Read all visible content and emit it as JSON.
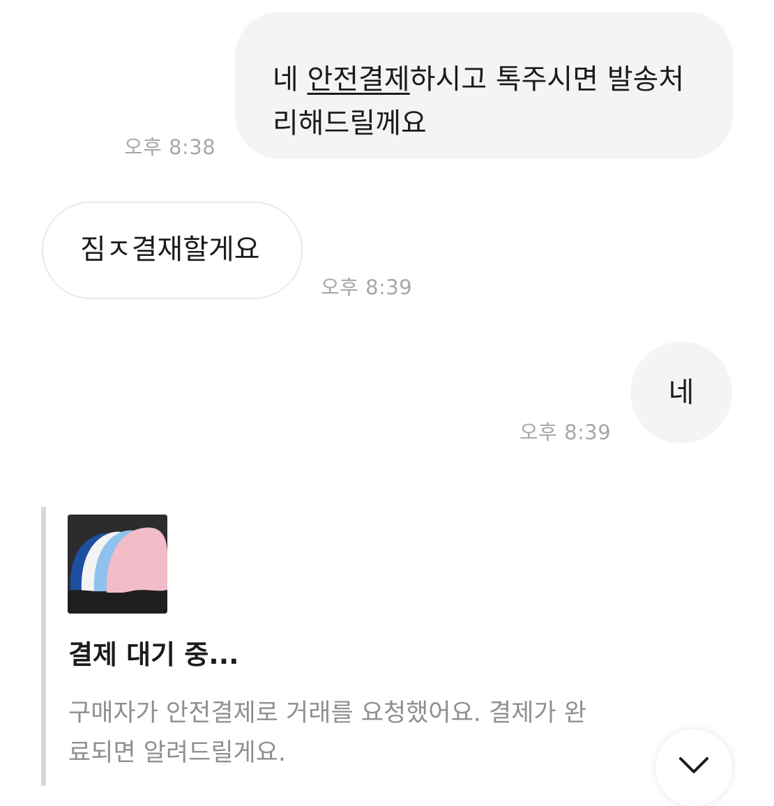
{
  "messages": [
    {
      "direction": "outgoing",
      "text_before_link": "네 ",
      "link_text": "안전결제",
      "text_after_link": "하시고 톡주시면 발송처",
      "text_line2": "리해드릴께요",
      "time": "오후 8:38"
    },
    {
      "direction": "incoming",
      "text": "짐ㅈ결재할게요",
      "time": "오후 8:39"
    },
    {
      "direction": "outgoing",
      "text": "네",
      "time": "오후 8:39"
    }
  ],
  "payment_card": {
    "thumbnail_icon": "product-thumbnail",
    "title": "결제 대기 중...",
    "description": "구매자가 안전결제로 거래를 요청했어요. 결제가 완료되면 알려드릴게요."
  },
  "scroll_button": {
    "icon": "chevron-down-icon"
  },
  "colors": {
    "outgoing_bubble": "#f4f4f4",
    "incoming_border": "#e9e9e9",
    "timestamp": "#a7a7a7",
    "card_bar": "#d7d7d7",
    "description_text": "#8f8f8f"
  }
}
